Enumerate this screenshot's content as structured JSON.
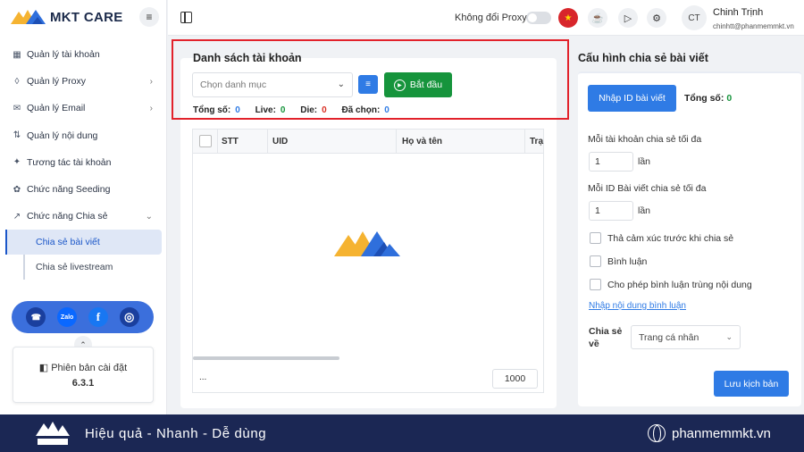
{
  "app": {
    "name": "MKT CARE"
  },
  "sidebar": {
    "items": [
      {
        "label": "Quản lý tài khoản",
        "icon": "grid-icon",
        "has_chevron": false
      },
      {
        "label": "Quản lý Proxy",
        "icon": "layers-icon",
        "has_chevron": true
      },
      {
        "label": "Quản lý Email",
        "icon": "mail-icon",
        "has_chevron": true
      },
      {
        "label": "Quản lý nội dung",
        "icon": "content-icon",
        "has_chevron": false
      },
      {
        "label": "Tương tác tài khoản",
        "icon": "sparkle-icon",
        "has_chevron": false
      },
      {
        "label": "Chức năng Seeding",
        "icon": "seed-icon",
        "has_chevron": false
      },
      {
        "label": "Chức năng Chia sẻ",
        "icon": "share-icon",
        "has_chevron": true
      }
    ],
    "subitems": [
      {
        "label": "Chia sẻ bài viết",
        "active": true
      },
      {
        "label": "Chia sẻ livestream",
        "active": false
      }
    ],
    "social": [
      "Zalo"
    ],
    "version_label": "Phiên bản cài đặt",
    "version": "6.3.1"
  },
  "topbar": {
    "proxy_label": "Không đổi Proxy",
    "proxy_toggle_on": false,
    "avatar_initials": "CT",
    "user_name": "Chinh Trịnh",
    "user_email": "chinhtt@phanmemmkt.vn"
  },
  "accounts_panel": {
    "title": "Danh sách tài khoản",
    "category_placeholder": "Chọn danh mục",
    "start_label": "Bắt đầu",
    "stats": [
      {
        "label": "Tổng số:",
        "value": "0",
        "color": "#2f7be5"
      },
      {
        "label": "Live:",
        "value": "0",
        "color": "#16943c"
      },
      {
        "label": "Die:",
        "value": "0",
        "color": "#d93025"
      },
      {
        "label": "Đã chọn:",
        "value": "0",
        "color": "#2f7be5"
      }
    ],
    "columns": [
      "STT",
      "UID",
      "Họ và tên",
      "Trạ"
    ],
    "footer_ellipsis": "...",
    "page_size": "1000"
  },
  "config_panel": {
    "title": "Cấu hình chia sẻ bài viết",
    "import_button": "Nhập ID bài viết",
    "total_label": "Tổng số:",
    "total_value": "0",
    "per_account_label": "Mỗi tài khoản chia sẻ tối đa",
    "per_account_value": "1",
    "per_account_unit": "lần",
    "per_post_label": "Mỗi ID Bài viết chia sẻ tối đa",
    "per_post_value": "1",
    "per_post_unit": "lần",
    "options": [
      {
        "label": "Thả cảm xúc trước khi chia sẻ",
        "checked": false
      },
      {
        "label": "Bình luận",
        "checked": false
      },
      {
        "label": "Cho phép bình luận trùng nội dung",
        "checked": false
      }
    ],
    "comment_link": "Nhập nội dung bình luận",
    "share_to_label": "Chia sẻ về",
    "share_to_value": "Trang cá nhân",
    "save_button": "Lưu kịch bản"
  },
  "footer": {
    "slogan": "Hiệu quả - Nhanh - Dễ dùng",
    "site": "phanmemmkt.vn"
  },
  "colors": {
    "primary": "#2f7be5",
    "success": "#16943c",
    "danger": "#d93025",
    "footer_bg": "#1b2754",
    "highlight": "#e2222b"
  }
}
